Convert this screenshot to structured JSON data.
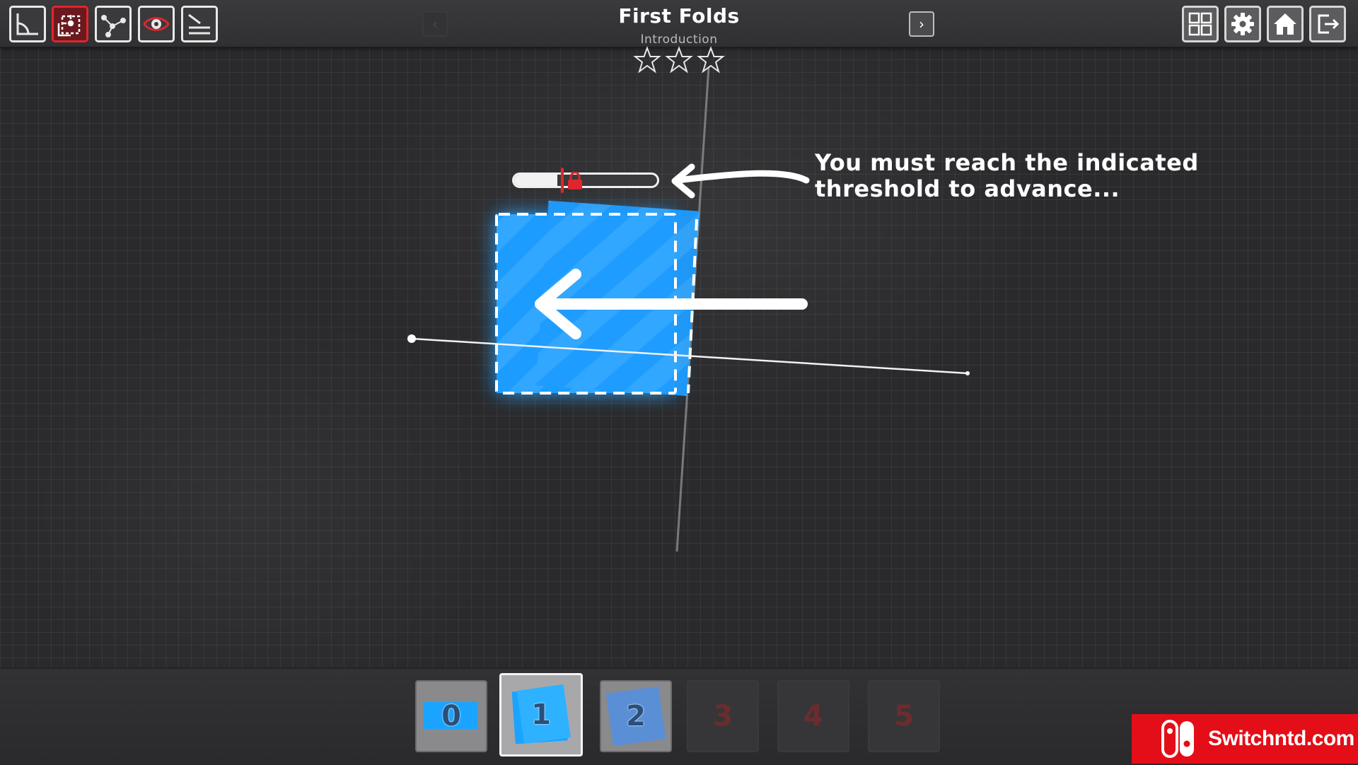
{
  "header": {
    "title": "First Folds",
    "subtitle": "Introduction",
    "prev_label": "‹",
    "next_label": "›",
    "stars_total": 3,
    "stars_earned": 0
  },
  "toolbar": {
    "tools": [
      {
        "name": "angle-tool",
        "icon": "angle-icon",
        "active": false
      },
      {
        "name": "fold-tool",
        "icon": "fold-select-icon",
        "active": true
      },
      {
        "name": "point-tool",
        "icon": "points-icon",
        "active": false
      },
      {
        "name": "view-tool",
        "icon": "eye-icon",
        "active": false
      },
      {
        "name": "layers-tool",
        "icon": "layers-icon",
        "active": false
      }
    ],
    "right_buttons": [
      {
        "name": "level-select",
        "icon": "grid-icon"
      },
      {
        "name": "settings",
        "icon": "gear-icon"
      },
      {
        "name": "home",
        "icon": "home-icon"
      },
      {
        "name": "exit",
        "icon": "exit-icon"
      }
    ]
  },
  "tutorial": {
    "hint_line1": "You must reach the indicated",
    "hint_line2": "threshold to advance..."
  },
  "progress": {
    "value": 0.3,
    "threshold": 0.35
  },
  "colors": {
    "paper": "#1e9cff",
    "accent_red": "#e0262c",
    "background": "#2a2a2c",
    "watermark_red": "#e30e17"
  },
  "steps": [
    {
      "label": "0",
      "state": "done"
    },
    {
      "label": "1",
      "state": "selected"
    },
    {
      "label": "2",
      "state": "done"
    },
    {
      "label": "3",
      "state": "locked"
    },
    {
      "label": "4",
      "state": "locked"
    },
    {
      "label": "5",
      "state": "locked"
    }
  ],
  "watermark": {
    "text": "Switchntd.com"
  }
}
